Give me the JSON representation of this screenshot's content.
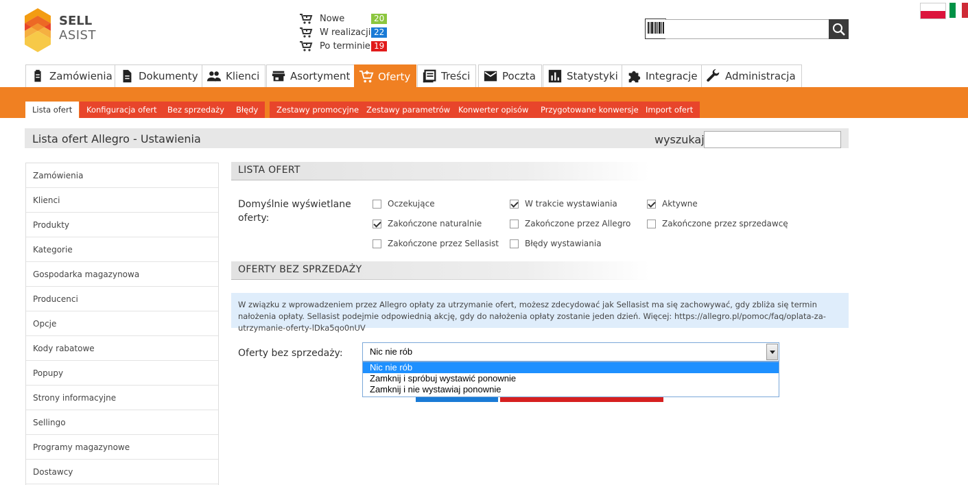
{
  "logo": {
    "line1": "SELL",
    "line2": "ASIST"
  },
  "counters": [
    {
      "label": "Nowe",
      "count": "20",
      "color": "#8cc63f"
    },
    {
      "label": "W realizacji",
      "count": "22",
      "color": "#1a7bd6"
    },
    {
      "label": "Po terminie",
      "count": "19",
      "color": "#e11b1b"
    }
  ],
  "search": {
    "placeholder": "",
    "value": ""
  },
  "main_tabs": [
    {
      "label": "Zamówienia",
      "icon": "clipboard-icon"
    },
    {
      "label": "Dokumenty",
      "icon": "document-icon"
    },
    {
      "label": "Klienci",
      "icon": "people-icon"
    },
    {
      "label": "Asortyment",
      "icon": "store-icon"
    },
    {
      "label": "Oferty",
      "icon": "cart-icon",
      "active": true
    },
    {
      "label": "Treści",
      "icon": "list-icon"
    },
    {
      "label": "Poczta",
      "icon": "mail-icon"
    },
    {
      "label": "Statystyki",
      "icon": "chart-icon"
    },
    {
      "label": "Integracje",
      "icon": "puzzle-icon"
    },
    {
      "label": "Administracja",
      "icon": "wrench-icon"
    }
  ],
  "sub_tabs": [
    {
      "label": "Lista ofert",
      "active": true
    },
    {
      "label": "Konfiguracja ofert"
    },
    {
      "label": "Bez sprzedaży"
    },
    {
      "label": "Błędy"
    },
    {
      "label": "Zestawy promocyjne"
    },
    {
      "label": "Zestawy parametrów"
    },
    {
      "label": "Konwerter opisów"
    },
    {
      "label": "Przygotowane konwersje"
    },
    {
      "label": "Import ofert"
    }
  ],
  "page": {
    "title": "Lista ofert Allegro - Ustawienia",
    "search_label": "wyszukaj:"
  },
  "sidebar": {
    "items": [
      "Zamówienia",
      "Klienci",
      "Produkty",
      "Kategorie",
      "Gospodarka magazynowa",
      "Producenci",
      "Opcje",
      "Kody rabatowe",
      "Popupy",
      "Strony informacyjne",
      "Sellingo",
      "Programy magazynowe",
      "Dostawcy"
    ]
  },
  "section_list": {
    "title": "LISTA OFERT",
    "field_label": "Domyślnie wyświetlane oferty:",
    "checkboxes": [
      {
        "label": "Oczekujące",
        "checked": false
      },
      {
        "label": "W trakcie wystawiania",
        "checked": true
      },
      {
        "label": "Aktywne",
        "checked": true
      },
      {
        "label": "Zakończone naturalnie",
        "checked": true
      },
      {
        "label": "Zakończone przez Allegro",
        "checked": false
      },
      {
        "label": "Zakończone przez sprzedawcę",
        "checked": false
      },
      {
        "label": "Zakończone przez Sellasist",
        "checked": false
      },
      {
        "label": "Błędy wystawiania",
        "checked": false
      }
    ]
  },
  "section_nosale": {
    "title": "OFERTY BEZ SPRZEDAŻY",
    "info": "W związku z wprowadzeniem przez Allegro opłaty za utrzymanie ofert, możesz zdecydować jak Sellasist ma się zachowywać, gdy zbliża się termin nałożenia opłaty. Sellasist podejmie odpowiednią akcję, gdy do nałożenia opłaty zostanie jeden dzień. Więcej: https://allegro.pl/pomoc/faq/oplata-za-utrzymanie-oferty-lDka5qo0nUV",
    "field_label": "Oferty bez sprzedaży:",
    "selected": "Nic nie rób",
    "options": [
      "Nic nie rób",
      "Zamknij i spróbuj wystawić ponownie",
      "Zamknij i nie wystawiaj ponownie"
    ]
  }
}
